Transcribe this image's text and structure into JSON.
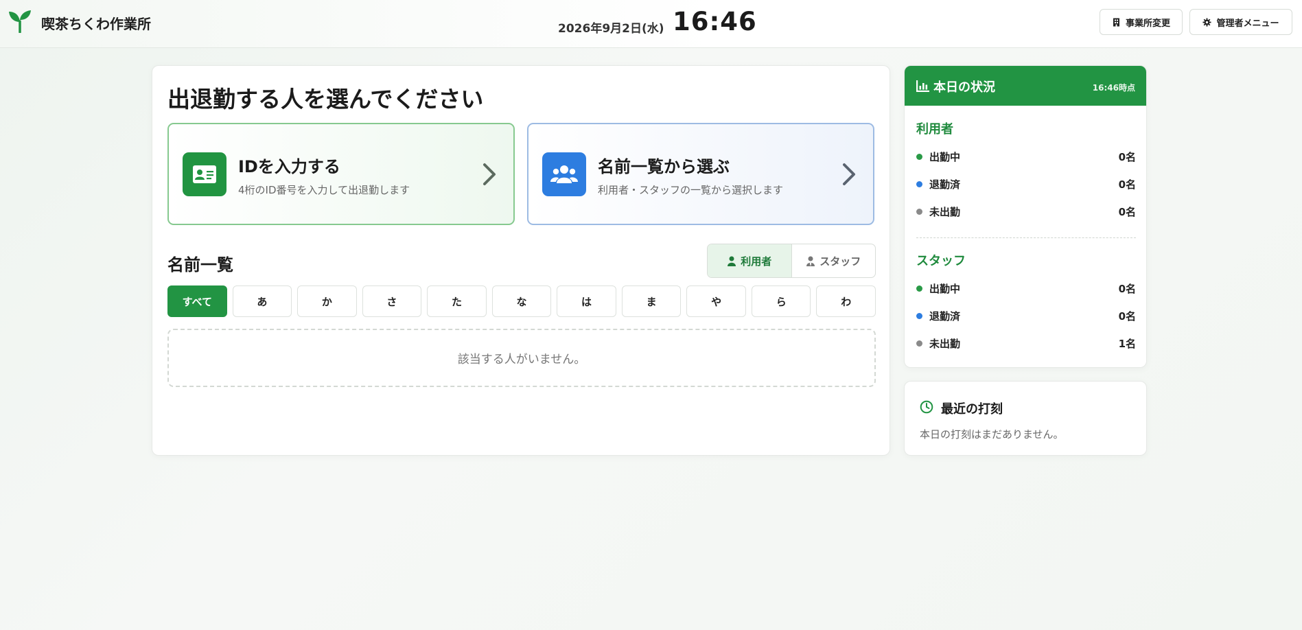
{
  "header": {
    "app_title": "喫茶ちくわ作業所",
    "date": "2026年9月2日(水)",
    "time": "16:46",
    "office_button": "事業所変更",
    "admin_button": "管理者メニュー",
    "icons": [
      "sprout-logo",
      "building-icon",
      "gear-icon"
    ]
  },
  "main": {
    "title": "出退勤する人を選んでください",
    "id_card": {
      "title": "IDを入力する",
      "desc": "4桁のID番号を入力して出退勤します",
      "icon": "id-card-icon"
    },
    "list_card": {
      "title": "名前一覧から選ぶ",
      "desc": "利用者・スタッフの一覧から選択します",
      "icon": "users-icon"
    },
    "list_title": "名前一覧",
    "toggle": {
      "user": "利用者",
      "staff": "スタッフ",
      "selected": "利用者"
    },
    "kana": [
      "すべて",
      "あ",
      "か",
      "さ",
      "た",
      "な",
      "は",
      "ま",
      "や",
      "ら",
      "わ"
    ],
    "kana_selected": "すべて",
    "empty_message": "該当する人がいません。"
  },
  "status": {
    "title": "本日の状況",
    "as_of": "16:46時点",
    "users": {
      "title": "利用者",
      "rows": [
        {
          "label": "出勤中",
          "count": "0名",
          "color": "#2a9a47"
        },
        {
          "label": "退勤済",
          "count": "0名",
          "color": "#2d7de0"
        },
        {
          "label": "未出勤",
          "count": "0名",
          "color": "#8a8a8a"
        }
      ]
    },
    "staff": {
      "title": "スタッフ",
      "rows": [
        {
          "label": "出勤中",
          "count": "0名",
          "color": "#2a9a47"
        },
        {
          "label": "退勤済",
          "count": "0名",
          "color": "#2d7de0"
        },
        {
          "label": "未出勤",
          "count": "1名",
          "color": "#8a8a8a"
        }
      ]
    }
  },
  "recent": {
    "title": "最近の打刻",
    "empty": "本日の打刻はまだありません。"
  },
  "colors": {
    "accent_green": "#229443",
    "accent_blue": "#2d7de0"
  }
}
